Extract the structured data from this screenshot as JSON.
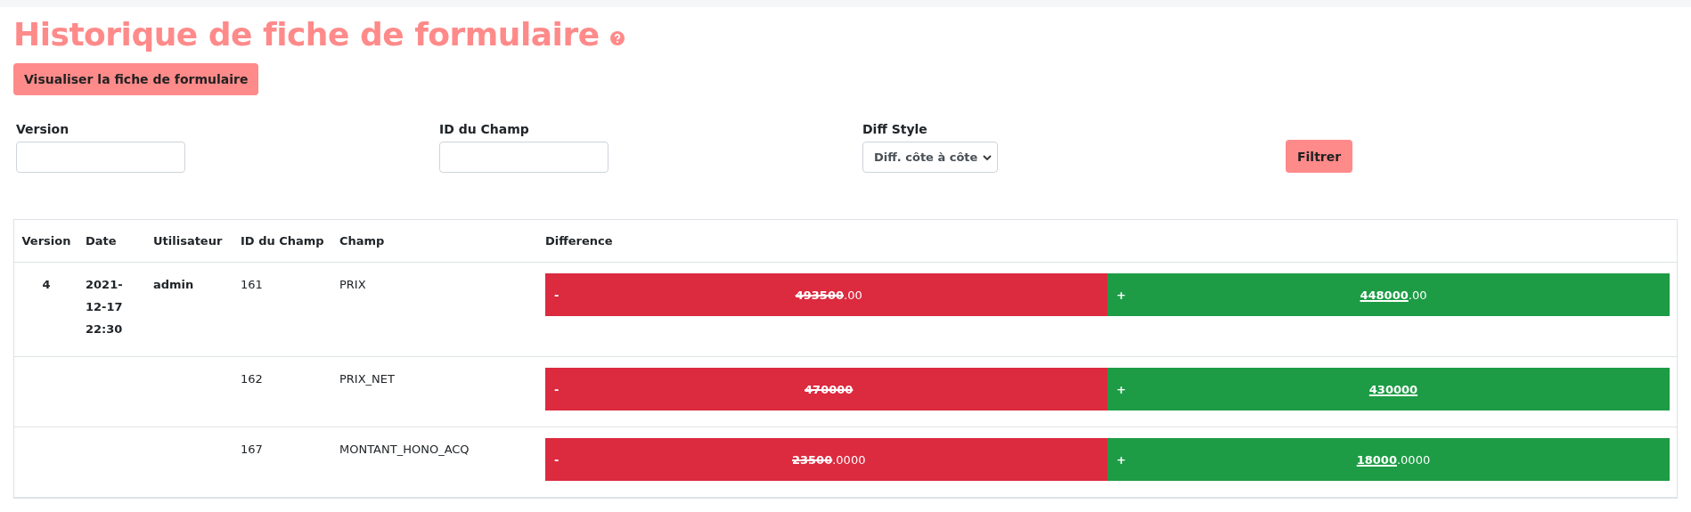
{
  "title": "Historique de fiche de formulaire",
  "view_button": "Visualiser la fiche de formulaire",
  "filters": [
    {
      "kind": "input",
      "label": "Version"
    },
    {
      "kind": "input",
      "label": "ID du Champ"
    },
    {
      "kind": "select",
      "label": "Diff Style",
      "value": "Diff. côte à côte"
    }
  ],
  "filter_button": "Filtrer",
  "table": {
    "columns": [
      "Version",
      "Date",
      "Utilisateur",
      "ID du Champ",
      "Champ",
      "Difference"
    ],
    "rows": [
      {
        "version": "4",
        "date": "2021-12-17 22:30",
        "user": "admin",
        "field_id": "161",
        "field": "PRIX",
        "old": {
          "sign": "-",
          "changed": "493500",
          "unchanged": ".00"
        },
        "new": {
          "sign": "+",
          "changed": "448000",
          "unchanged": ".00"
        }
      },
      {
        "field_id": "162",
        "field": "PRIX_NET",
        "old": {
          "sign": "-",
          "changed": "470000"
        },
        "new": {
          "sign": "+",
          "changed": "430000"
        }
      },
      {
        "field_id": "167",
        "field": "MONTANT_HONO_ACQ",
        "old": {
          "sign": "-",
          "changed": "23500",
          "unchanged": ".0000"
        },
        "new": {
          "sign": "+",
          "changed": "18000",
          "unchanged": ".0000"
        }
      }
    ]
  }
}
